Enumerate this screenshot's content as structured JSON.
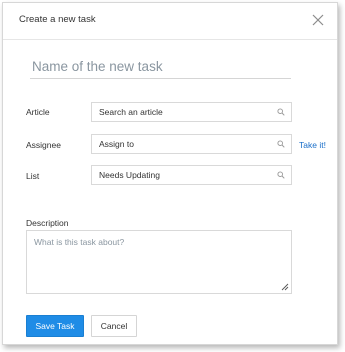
{
  "dialog": {
    "title": "Create a new task"
  },
  "task_name": {
    "placeholder": "Name of the new task"
  },
  "fields": {
    "article": {
      "label": "Article",
      "placeholder": "Search an article"
    },
    "assignee": {
      "label": "Assignee",
      "placeholder": "Assign to",
      "take_it_label": "Take it!"
    },
    "list": {
      "label": "List",
      "value": "Needs Updating"
    }
  },
  "description": {
    "label": "Description",
    "placeholder": "What is this task about?"
  },
  "actions": {
    "save_label": "Save Task",
    "cancel_label": "Cancel"
  },
  "colors": {
    "primary_button": "#1f8ce6",
    "link": "#1a6fc9"
  },
  "icons": {
    "close": "close-icon",
    "search": "search-icon",
    "resize": "resize-handle-icon"
  }
}
